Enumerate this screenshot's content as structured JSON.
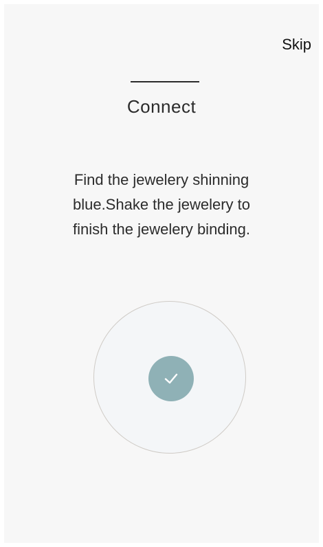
{
  "header": {
    "skip_label": "Skip"
  },
  "page": {
    "title": "Connect",
    "instructions": [
      "Find the jewelery shinning",
      "blue.Shake the jewelery to",
      "finish the jewelery binding."
    ]
  },
  "status": {
    "icon": "check-icon",
    "badge_color": "#8fb1b6"
  }
}
